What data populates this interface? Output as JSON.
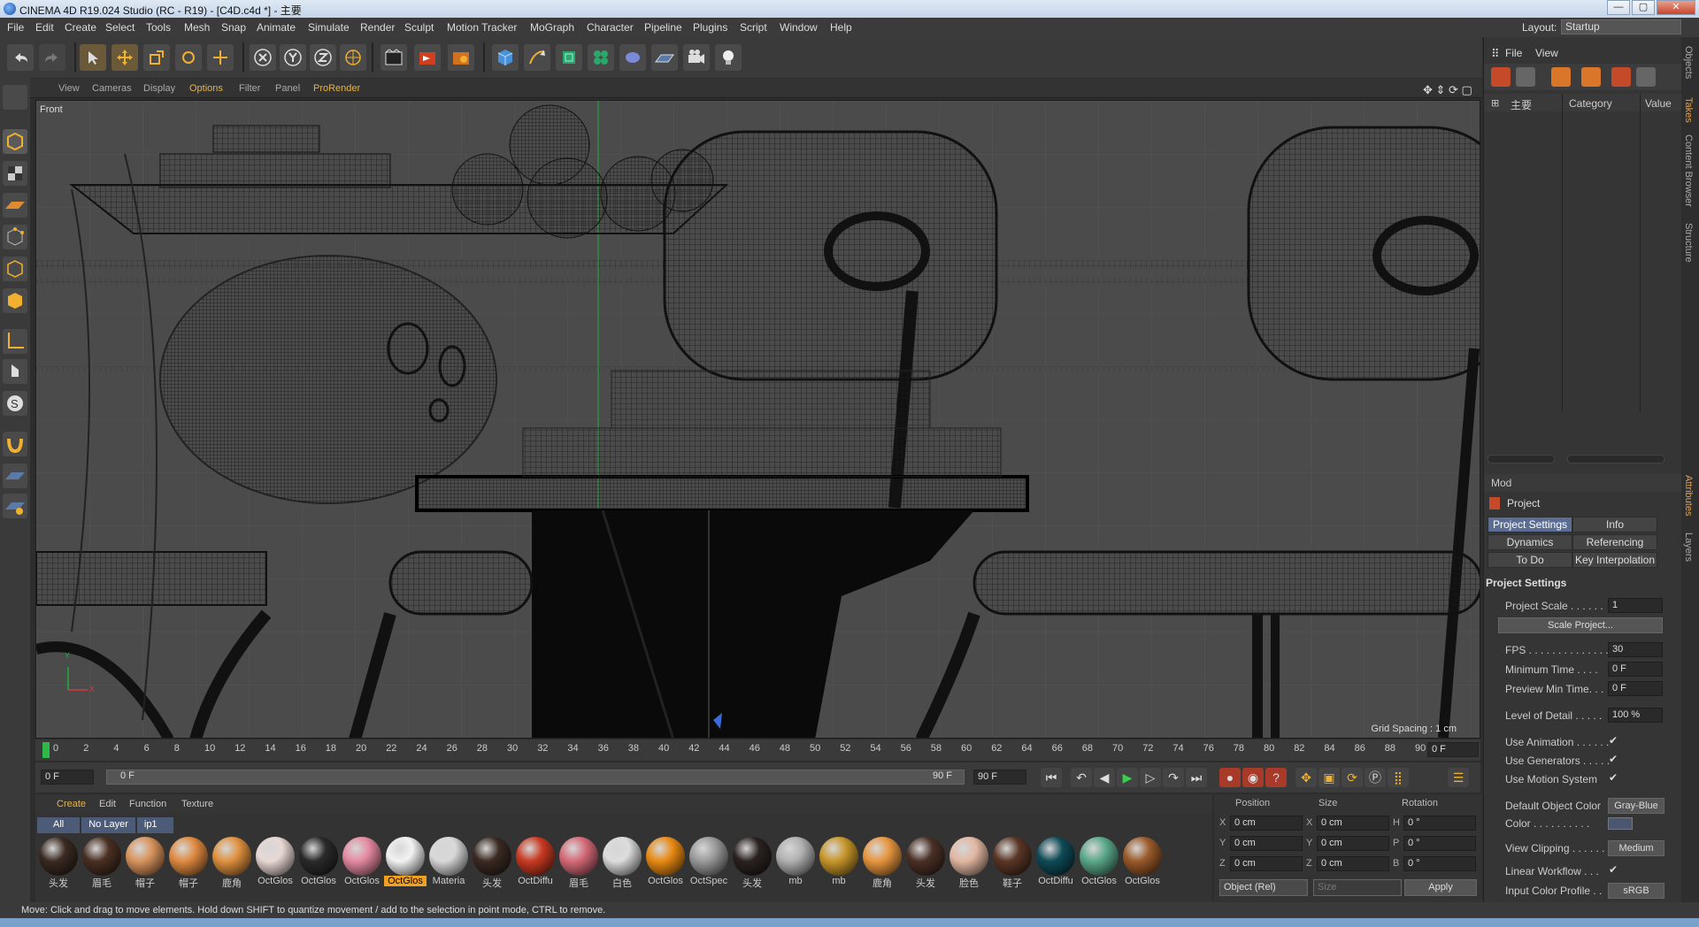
{
  "window": {
    "title": "CINEMA 4D R19.024 Studio (RC - R19) - [C4D.c4d *] - 主要",
    "min": "—",
    "max": "▢",
    "close": "✕"
  },
  "menu": [
    "File",
    "Edit",
    "Create",
    "Select",
    "Tools",
    "Mesh",
    "Snap",
    "Animate",
    "Simulate",
    "Render",
    "Sculpt",
    "Motion Tracker",
    "MoGraph",
    "Character",
    "Pipeline",
    "Plugins",
    "Script",
    "Window",
    "Help"
  ],
  "layout": {
    "label": "Layout:",
    "value": "Startup"
  },
  "viewport": {
    "menu": [
      "View",
      "Cameras",
      "Display",
      "Options",
      "Filter",
      "Panel",
      "ProRender"
    ],
    "name": "Front",
    "grid_spacing": "Grid Spacing : 1 cm",
    "axis_y": "Y",
    "axis_x": "X"
  },
  "timeline": {
    "ticks": [
      "0",
      "2",
      "4",
      "6",
      "8",
      "10",
      "12",
      "14",
      "16",
      "18",
      "20",
      "22",
      "24",
      "26",
      "28",
      "30",
      "32",
      "34",
      "36",
      "38",
      "40",
      "42",
      "44",
      "46",
      "48",
      "50",
      "52",
      "54",
      "56",
      "58",
      "60",
      "62",
      "64",
      "66",
      "68",
      "70",
      "72",
      "74",
      "76",
      "78",
      "80",
      "82",
      "84",
      "86",
      "88",
      "90"
    ],
    "current_frame": "0 F",
    "start_frame": "0 F",
    "range_start": "0 F",
    "range_end": "90 F",
    "end_frame": "90 F"
  },
  "materials": {
    "menu": [
      "Create",
      "Edit",
      "Function",
      "Texture"
    ],
    "filters": [
      "All",
      "No Layer",
      "ip1"
    ],
    "items": [
      {
        "label": "头发",
        "color": "#3a2a22"
      },
      {
        "label": "眉毛",
        "color": "#4a2f22"
      },
      {
        "label": "帽子",
        "color": "#d8935c"
      },
      {
        "label": "帽子",
        "color": "#e08a40"
      },
      {
        "label": "鹿角",
        "color": "#e0913f"
      },
      {
        "label": "OctGlos",
        "color": "#e8d8d4"
      },
      {
        "label": "OctGlos",
        "color": "#2a2a2a"
      },
      {
        "label": "OctGlos",
        "color": "#e58aa0"
      },
      {
        "label": "OctGlos",
        "color": "#f2f2f2"
      },
      {
        "label": "Materia",
        "color": "#d8d8d8"
      },
      {
        "label": "头发",
        "color": "#3a2a22"
      },
      {
        "label": "OctDiffu",
        "color": "#c83a22"
      },
      {
        "label": "眉毛",
        "color": "#d66a78"
      },
      {
        "label": "白色",
        "color": "#dcdcdc"
      },
      {
        "label": "OctGlos",
        "color": "#e88a14"
      },
      {
        "label": "OctSpec",
        "color": "#9a9a9a"
      },
      {
        "label": "头发",
        "color": "#2a2220"
      },
      {
        "label": "mb",
        "color": "#b0b0b0"
      },
      {
        "label": "mb",
        "color": "#c8962a"
      },
      {
        "label": "鹿角",
        "color": "#e8963e"
      },
      {
        "label": "头发",
        "color": "#4a3026"
      },
      {
        "label": "脸色",
        "color": "#e2b8a2"
      },
      {
        "label": "鞋子",
        "color": "#5a3626"
      },
      {
        "label": "OctDiffu",
        "color": "#0e4a56"
      },
      {
        "label": "OctGlos",
        "color": "#5aa88a"
      },
      {
        "label": "OctGlos",
        "color": "#9a5a2a"
      }
    ],
    "selected_index": 8
  },
  "coordinates": {
    "headers": [
      "Position",
      "Size",
      "Rotation"
    ],
    "rows": [
      {
        "axis": "X",
        "pos": "0 cm",
        "size_axis": "X",
        "size": "0 cm",
        "rot_axis": "H",
        "rot": "0 °"
      },
      {
        "axis": "Y",
        "pos": "0 cm",
        "size_axis": "Y",
        "size": "0 cm",
        "rot_axis": "P",
        "rot": "0 °"
      },
      {
        "axis": "Z",
        "pos": "0 cm",
        "size_axis": "Z",
        "size": "0 cm",
        "rot_axis": "B",
        "rot": "0 °"
      }
    ],
    "mode": "Object (Rel)",
    "size_mode": "Size",
    "apply": "Apply"
  },
  "objects_panel": {
    "menu": [
      "File",
      "View"
    ],
    "take_columns": [
      "主要",
      "Category",
      "Value"
    ]
  },
  "attributes": {
    "menu": "Mod",
    "title": "Project",
    "tabs": [
      "Project Settings",
      "Info",
      "Dynamics",
      "Referencing",
      "To Do",
      "Key Interpolation"
    ],
    "section": "Project Settings",
    "project_scale_label": "Project Scale . . . . . .",
    "project_scale": "1",
    "scale_project_btn": "Scale Project...",
    "fps_label": "FPS . . . . . . . . . . . . . .",
    "fps": "30",
    "min_time_label": "Minimum Time . . . .",
    "min_time": "0 F",
    "preview_min_label": "Preview Min Time. . .",
    "preview_min": "0 F",
    "lod_label": "Level of Detail . . . . .",
    "lod": "100 %",
    "use_animation": "Use Animation . . . . . .",
    "use_generators": "Use Generators . . . . .",
    "use_motion": "Use Motion System",
    "check": "✔",
    "default_color_label": "Default Object Color",
    "default_color": "Gray-Blue",
    "color_label": "Color . . . . . . . . . .",
    "view_clipping_label": "View Clipping . . . . . .",
    "view_clipping": "Medium",
    "linear_workflow": "Linear Workflow . . .",
    "input_profile_label": "Input Color Profile . .",
    "input_profile": "sRGB"
  },
  "side_tabs": [
    "Objects",
    "Takes",
    "Content Browser",
    "Structure",
    "Attributes",
    "Layers"
  ],
  "status": "Move: Click and drag to move elements. Hold down SHIFT to quantize movement / add to the selection in point mode, CTRL to remove."
}
